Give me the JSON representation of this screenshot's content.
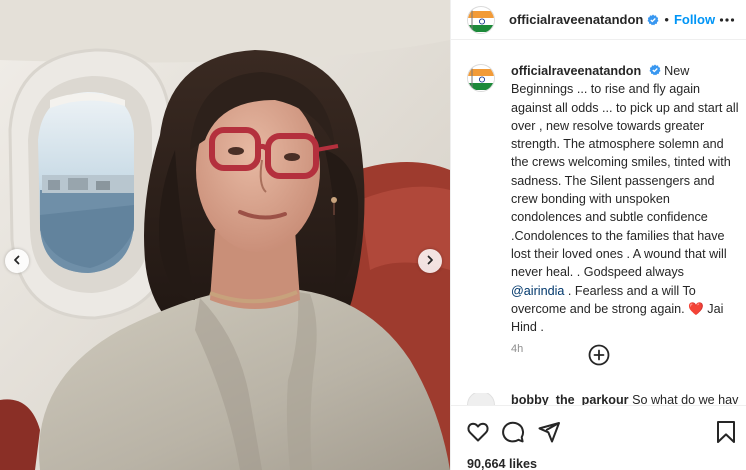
{
  "post": {
    "username": "officialraveenatandon",
    "follow_label": "Follow",
    "separator": "•",
    "caption_user": "officialraveenatandon",
    "caption_part1": "New Beginnings ... to rise and fly again against all odds ... to pick up and start all over , new resolve towards greater strength. The atmosphere solemn and the crews welcoming smiles, tinted with sadness. The Silent passengers and crew bonding with unspoken condolences and subtle confidence .Condolences to the families that have lost their loved ones . A wound that will never heal. . Godspeed always ",
    "caption_mention": "@airindia",
    "caption_part2": " . Fearless and a will To overcome and be strong again. ",
    "caption_heart": "❤️",
    "caption_part3": " Jai Hind .",
    "time_ago": "4h",
    "likes": "90,664 likes"
  },
  "comment_preview": {
    "username": "bobby_the_parkour",
    "text": "So what do we have"
  },
  "icons": {
    "avatar": "india-flag-icon",
    "verified": "verified-badge-icon",
    "more": "more-options-icon",
    "load_more": "plus-circle-icon",
    "like": "heart-icon",
    "comment": "comment-icon",
    "share": "send-icon",
    "save": "bookmark-icon",
    "prev": "chevron-left-icon",
    "next": "chevron-right-icon"
  },
  "colors": {
    "link": "#0095f6",
    "mention": "#00376b",
    "verified": "#3897f0",
    "heart": "#ed4956"
  }
}
